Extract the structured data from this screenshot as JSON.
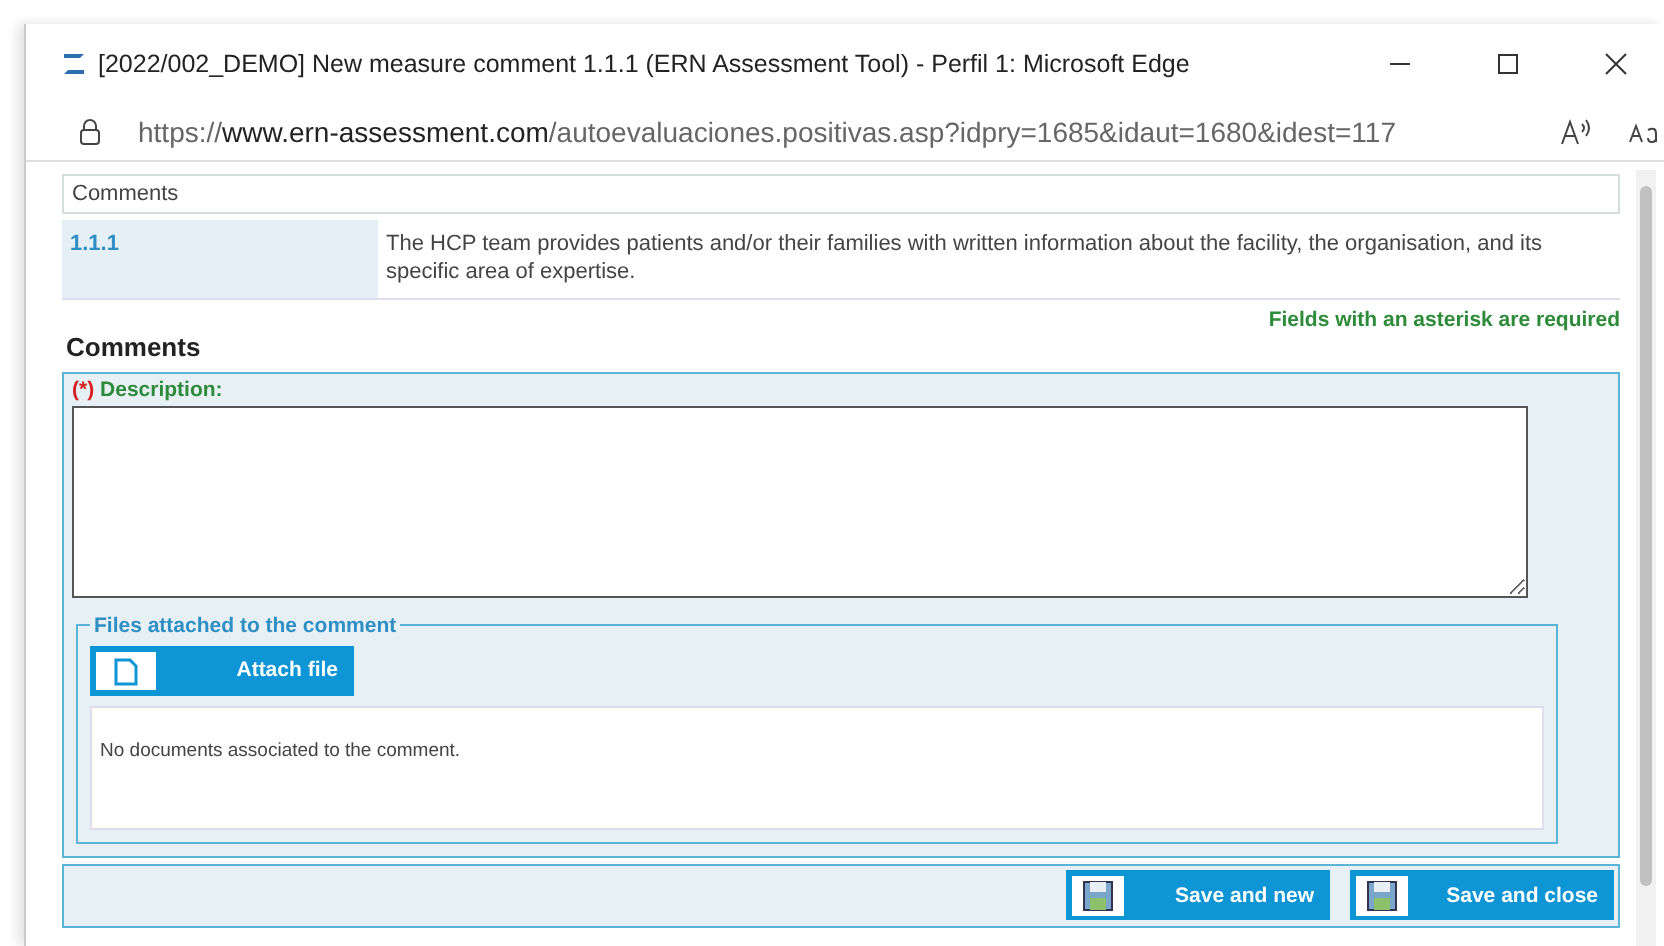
{
  "window": {
    "title": "[2022/002_DEMO] New measure comment 1.1.1 (ERN Assessment Tool) - Perfil 1: Microsoft Edge"
  },
  "address_bar": {
    "url_prefix": "https://",
    "url_domain": "www.ern-assessment.com",
    "url_path": "/autoevaluaciones.positivas.asp?idpry=1685&idaut=1680&idest=117"
  },
  "header": {
    "label": "Comments"
  },
  "measure": {
    "code": "1.1.1",
    "text": "The HCP team provides patients and/or their families with written information about the facility, the organisation, and its specific area of expertise."
  },
  "required_note": "Fields with an asterisk are required",
  "section_title": "Comments",
  "description": {
    "required_mark": "(*)",
    "label": "Description:"
  },
  "files": {
    "legend": "Files attached to the comment",
    "attach_button": "Attach file",
    "empty_message": "No documents associated to the comment."
  },
  "buttons": [
    {
      "label": "Save and new"
    },
    {
      "label": "Save and close"
    }
  ]
}
